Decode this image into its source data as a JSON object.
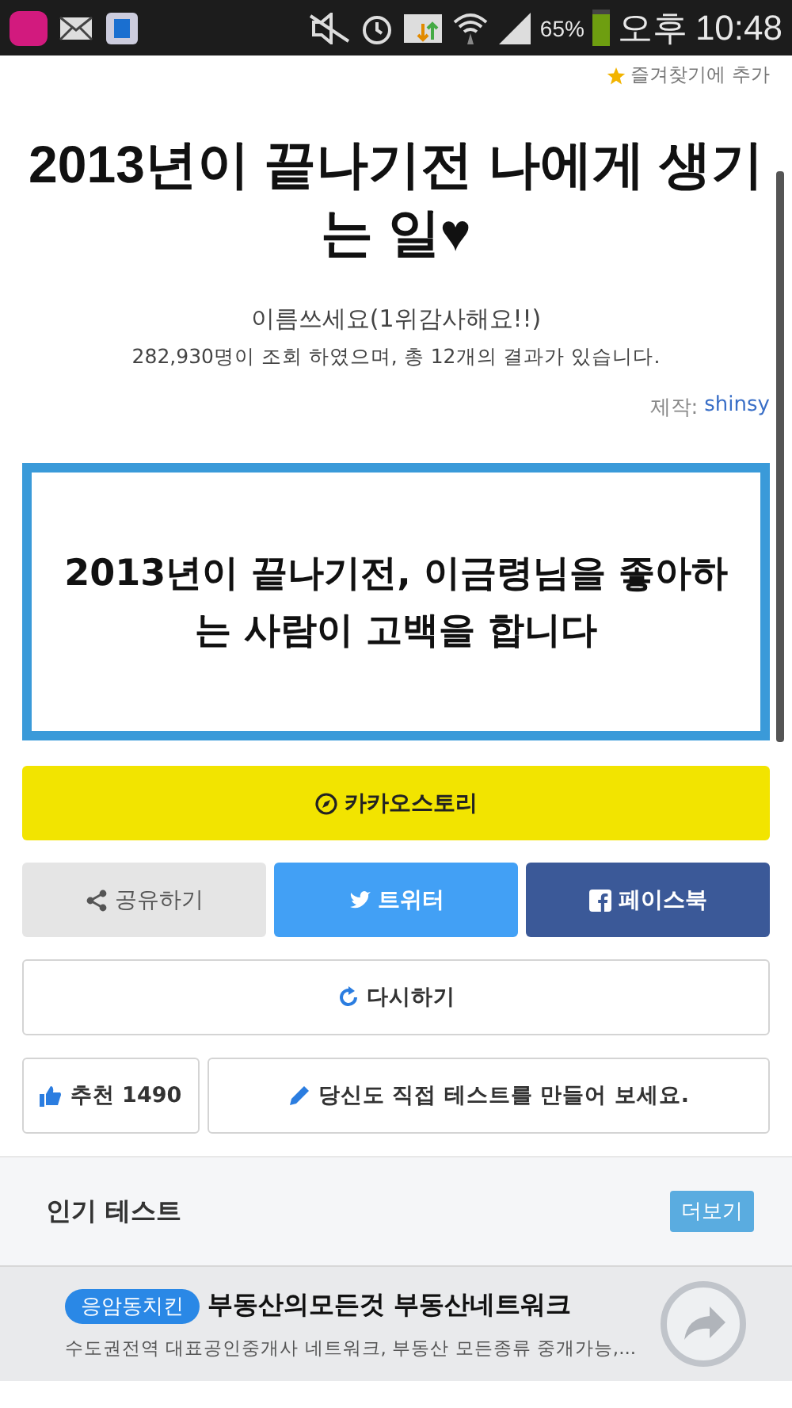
{
  "status_bar": {
    "battery": "65%",
    "time_period": "오후",
    "time": "10:48"
  },
  "favorite": {
    "label": "즐겨찾기에 추가"
  },
  "title": "2013년이 끝나기전 나에게 생기는 일♥",
  "subtitle": "이름쓰세요(1위감사해요!!)",
  "stats": "282,930명이 조회 하였으며, 총 12개의 결과가 있습니다.",
  "author": {
    "label": "제작:",
    "name": "shinsy"
  },
  "result": "2013년이 끝나기전, 이금령님을 좋아하는 사람이 고백을 합니다",
  "share_buttons": [
    {
      "kind": "kakaostory",
      "label": "카카오스토리"
    },
    {
      "kind": "share",
      "label": "공유하기"
    },
    {
      "kind": "twitter",
      "label": "트위터"
    },
    {
      "kind": "facebook",
      "label": "페이스북"
    }
  ],
  "retry": {
    "label": "다시하기"
  },
  "recommend": {
    "label": "추천 1490"
  },
  "make_test": {
    "label": "당신도 직접 테스트를 만들어 보세요."
  },
  "popular": {
    "title": "인기 테스트",
    "more": "더보기"
  },
  "ad": {
    "badge": "응암동치킨",
    "title": "부동산의모든것 부동산네트워크",
    "text": "수도권전역 대표공인중개사 네트워크, 부동산 모든종류 중개가능,..."
  }
}
